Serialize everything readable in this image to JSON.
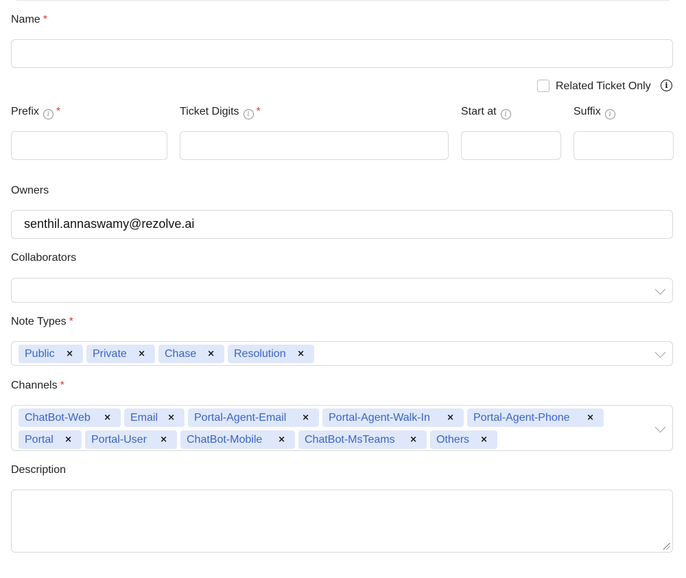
{
  "form": {
    "name": {
      "label": "Name",
      "required_mark": "*",
      "value": ""
    },
    "related_ticket_only": {
      "label": "Related Ticket Only",
      "checked": false,
      "icon": "info-icon"
    },
    "prefix": {
      "label": "Prefix",
      "required_mark": "*",
      "value": ""
    },
    "ticket_digits": {
      "label": "Ticket Digits",
      "required_mark": "*",
      "value": ""
    },
    "start_at": {
      "label": "Start at",
      "value": ""
    },
    "suffix": {
      "label": "Suffix",
      "value": ""
    },
    "owners": {
      "label": "Owners",
      "value": "senthil.annaswamy@rezolve.ai"
    },
    "collaborators": {
      "label": "Collaborators",
      "value": ""
    },
    "note_types": {
      "label": "Note Types",
      "required_mark": "*",
      "tags": [
        "Public",
        "Private",
        "Chase",
        "Resolution"
      ]
    },
    "channels": {
      "label": "Channels",
      "required_mark": "*",
      "tags": [
        "ChatBot-Web",
        "Email",
        "Portal-Agent-Email",
        "Portal-Agent-Walk-In",
        "Portal-Agent-Phone",
        "Portal",
        "Portal-User",
        "ChatBot-Mobile",
        "ChatBot-MsTeams",
        "Others"
      ]
    },
    "description": {
      "label": "Description",
      "value": ""
    }
  },
  "icons": {
    "info": "i",
    "remove": "×"
  },
  "colors": {
    "tag_bg": "#dfe8fa",
    "tag_text": "#3a63c7",
    "required": "#e0362c",
    "border": "#d9d9d9"
  }
}
